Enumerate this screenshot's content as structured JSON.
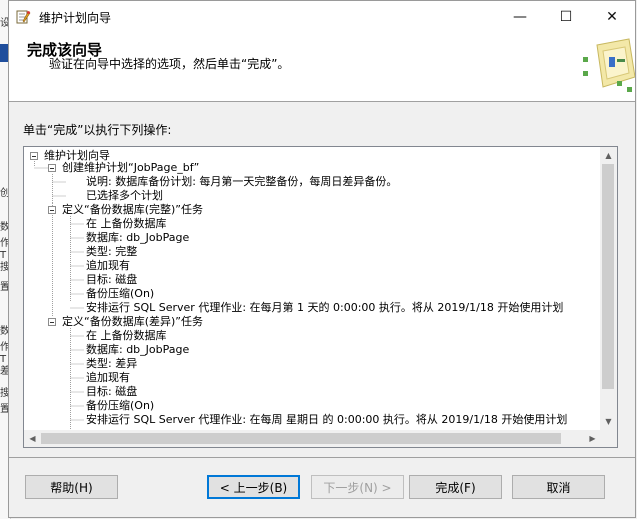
{
  "window": {
    "title": "维护计划向导",
    "min_icon": "—",
    "max_icon": "☐",
    "close_icon": "✕"
  },
  "header": {
    "title": "完成该向导",
    "description": "验证在向导中选择的选项，然后单击“完成”。"
  },
  "prompt": "单击“完成”以执行下列操作:",
  "tree": {
    "root": "维护计划向导",
    "plan": "创建维护计划“JobPage_bf”",
    "plan_desc": "说明: 数据库备份计划: 每月第一天完整备份，每周日差异备份。",
    "plan_multi": "已选择多个计划",
    "task1": "定义“备份数据库(完整)”任务",
    "task1_items": [
      "在  上备份数据库",
      "数据库: db_JobPage",
      "类型: 完整",
      "追加现有",
      "目标: 磁盘",
      "备份压缩(On)",
      "安排运行 SQL Server 代理作业: 在每月第 1 天的 0:00:00 执行。将从 2019/1/18 开始使用计划"
    ],
    "task2": "定义“备份数据库(差异)”任务",
    "task2_items": [
      "在  上备份数据库",
      "数据库: db_JobPage",
      "类型: 差异",
      "追加现有",
      "目标: 磁盘",
      "备份压缩(On)",
      "安排运行 SQL Server 代理作业: 在每周 星期日 的 0:00:00 执行。将从 2019/1/18 开始使用计划"
    ]
  },
  "buttons": {
    "help": "帮助(H)",
    "back": "< 上一步(B)",
    "next": "下一步(N) >",
    "finish": "完成(F)",
    "cancel": "取消"
  },
  "background_fragments": [
    "设",
    "创",
    "数",
    "作",
    "T",
    "搜",
    "置",
    "数",
    "作",
    "T",
    "差",
    "搜",
    "置"
  ]
}
